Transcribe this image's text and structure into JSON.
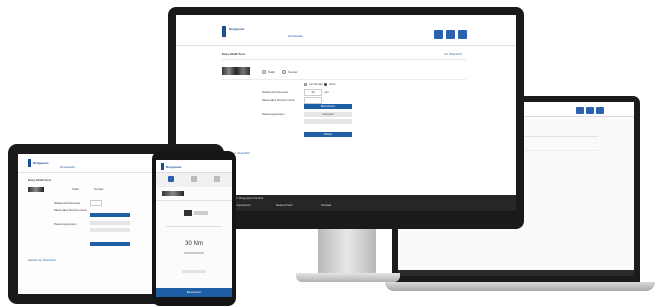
{
  "desktop": {
    "logo_name": "Ringspann",
    "nav_label": "Downloads",
    "header_icons": [
      "user-icon",
      "cart-icon",
      "menu-icon"
    ],
    "page_title": "Easy-Shaft-Tool",
    "back_link": "zur Übersicht",
    "radio_options": [
      "Stahl",
      "Sonder"
    ],
    "form": {
      "label_1": "Wellendurchmesser",
      "label_2": "Maximales Drehmoment",
      "label_3": "Passungssystem",
      "value_1": "30",
      "unit_1": "mm",
      "option_a": "mit Absatz",
      "option_b": "ohne",
      "button_1": "Berechnen",
      "select_value": "Auswahl",
      "button_2": "Weiter"
    },
    "footer_link": "Zurück zur Übersicht",
    "footer_text": "© Ringspann GmbH",
    "footer_links": [
      "Impressum",
      "Datenschutz",
      "Kontakt"
    ]
  },
  "phone": {
    "logo_name": "Ringspann",
    "big_value": "30 Nm",
    "bottom_button": "Berechnen"
  }
}
